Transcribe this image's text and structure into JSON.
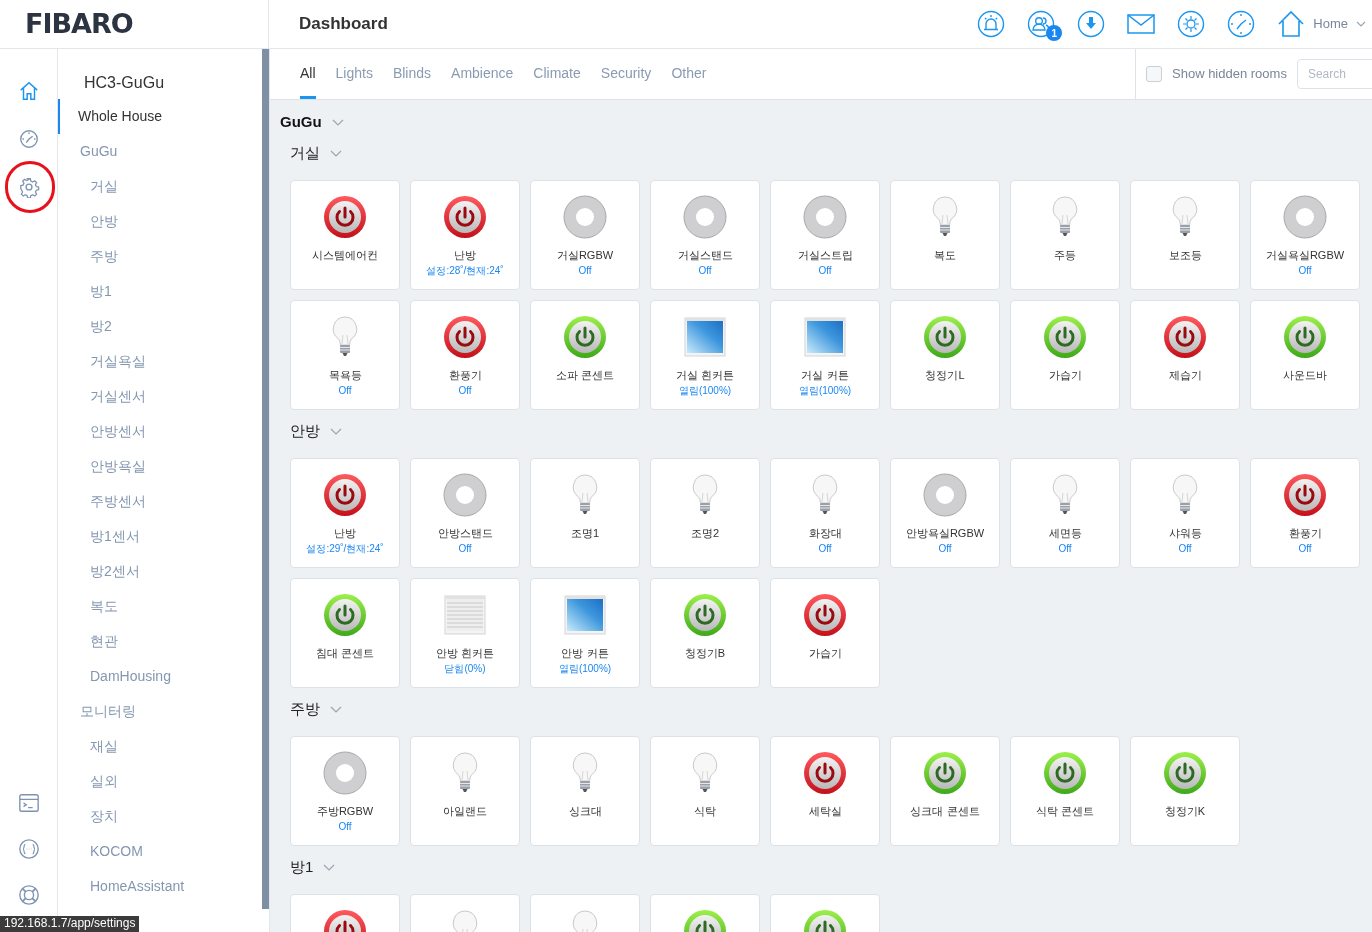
{
  "logo": "FIBARO",
  "page_title": "Dashboard",
  "header_icons": [
    {
      "kind": "alarm"
    },
    {
      "kind": "users",
      "badge": "1"
    },
    {
      "kind": "download"
    },
    {
      "kind": "mail"
    },
    {
      "kind": "sun"
    },
    {
      "kind": "clock"
    }
  ],
  "location": {
    "label": "Home"
  },
  "rail": [
    {
      "kind": "home",
      "selected": true,
      "highlighted": false
    },
    {
      "kind": "clock",
      "selected": false,
      "highlighted": false
    },
    {
      "kind": "settings",
      "selected": false,
      "highlighted": true
    }
  ],
  "rail_bottom": [
    {
      "kind": "terminal"
    },
    {
      "kind": "braces"
    },
    {
      "kind": "lifebuoy"
    }
  ],
  "sidebar": {
    "title": "HC3-GuGu",
    "items": [
      {
        "label": "Whole House",
        "selected": true
      },
      {
        "label": "GuGu",
        "selected": false,
        "children": [
          {
            "label": "거실"
          },
          {
            "label": "안방"
          },
          {
            "label": "주방"
          },
          {
            "label": "방1"
          },
          {
            "label": "방2"
          },
          {
            "label": "거실욕실"
          },
          {
            "label": "거실센서"
          },
          {
            "label": "안방센서"
          },
          {
            "label": "안방욕실"
          },
          {
            "label": "주방센서"
          },
          {
            "label": "방1센서"
          },
          {
            "label": "방2센서"
          },
          {
            "label": "복도"
          },
          {
            "label": "현관"
          },
          {
            "label": "DamHousing"
          }
        ]
      },
      {
        "label": "모니터링",
        "selected": false,
        "children": [
          {
            "label": "재실"
          },
          {
            "label": "실외"
          },
          {
            "label": "장치"
          },
          {
            "label": "KOCOM"
          },
          {
            "label": "HomeAssistant"
          }
        ]
      }
    ]
  },
  "tabs": [
    {
      "label": "All",
      "selected": true
    },
    {
      "label": "Lights",
      "selected": false
    },
    {
      "label": "Blinds",
      "selected": false
    },
    {
      "label": "Ambience",
      "selected": false
    },
    {
      "label": "Climate",
      "selected": false
    },
    {
      "label": "Security",
      "selected": false
    },
    {
      "label": "Other",
      "selected": false
    }
  ],
  "hidden_rooms": {
    "label": "Show hidden rooms",
    "checked": false
  },
  "search": {
    "placeholder": "Search"
  },
  "section": "GuGu",
  "rooms": [
    {
      "name": "거실",
      "devices": [
        {
          "kind": "switch",
          "on": false,
          "name": "시스템에어컨"
        },
        {
          "kind": "switch",
          "on": false,
          "name": "난방",
          "status": "설정:28˚/현재:24˚"
        },
        {
          "kind": "rgbw",
          "name": "거실RGBW",
          "status": "Off"
        },
        {
          "kind": "rgbw",
          "name": "거실스탠드",
          "status": "Off"
        },
        {
          "kind": "rgbw",
          "name": "거실스트립",
          "status": "Off"
        },
        {
          "kind": "bulb",
          "name": "복도"
        },
        {
          "kind": "bulb",
          "name": "주등"
        },
        {
          "kind": "bulb",
          "name": "보조등"
        },
        {
          "kind": "rgbw",
          "name": "거실욕실RGBW",
          "status": "Off"
        },
        {
          "kind": "bulb",
          "name": "목욕등",
          "status": "Off"
        },
        {
          "kind": "switch",
          "on": false,
          "name": "환풍기",
          "status": "Off"
        },
        {
          "kind": "switch",
          "on": true,
          "name": "소파 콘센트"
        },
        {
          "kind": "blind",
          "open": true,
          "name": "거실 흰커튼",
          "status": "열림(100%)"
        },
        {
          "kind": "blind",
          "open": true,
          "name": "거실 커튼",
          "status": "열림(100%)"
        },
        {
          "kind": "switch",
          "on": true,
          "name": "청정기L"
        },
        {
          "kind": "switch",
          "on": true,
          "name": "가습기"
        },
        {
          "kind": "switch",
          "on": false,
          "name": "제습기"
        },
        {
          "kind": "switch",
          "on": true,
          "name": "사운드바"
        }
      ]
    },
    {
      "name": "안방",
      "devices": [
        {
          "kind": "switch",
          "on": false,
          "name": "난방",
          "status": "설정:29˚/현재:24˚"
        },
        {
          "kind": "rgbw",
          "name": "안방스탠드",
          "status": "Off"
        },
        {
          "kind": "bulb",
          "name": "조명1"
        },
        {
          "kind": "bulb",
          "name": "조명2"
        },
        {
          "kind": "bulb",
          "name": "화장대",
          "status": "Off"
        },
        {
          "kind": "rgbw",
          "name": "안방욕실RGBW",
          "status": "Off"
        },
        {
          "kind": "bulb",
          "name": "세면등",
          "status": "Off"
        },
        {
          "kind": "bulb",
          "name": "샤워등",
          "status": "Off"
        },
        {
          "kind": "switch",
          "on": false,
          "name": "환풍기",
          "status": "Off"
        },
        {
          "kind": "switch",
          "on": true,
          "name": "침대 콘센트"
        },
        {
          "kind": "blind",
          "open": false,
          "name": "안방 흰커튼",
          "status": "닫힘(0%)"
        },
        {
          "kind": "blind",
          "open": true,
          "name": "안방 커튼",
          "status": "열림(100%)"
        },
        {
          "kind": "switch",
          "on": true,
          "name": "청정기B"
        },
        {
          "kind": "switch",
          "on": false,
          "name": "가습기"
        }
      ]
    },
    {
      "name": "주방",
      "devices": [
        {
          "kind": "rgbw",
          "name": "주방RGBW",
          "status": "Off"
        },
        {
          "kind": "bulb",
          "name": "아일랜드"
        },
        {
          "kind": "bulb",
          "name": "싱크대"
        },
        {
          "kind": "bulb",
          "name": "식탁"
        },
        {
          "kind": "switch",
          "on": false,
          "name": "세탁실"
        },
        {
          "kind": "switch",
          "on": true,
          "name": "싱크대 콘센트"
        },
        {
          "kind": "switch",
          "on": true,
          "name": "식탁 콘센트"
        },
        {
          "kind": "switch",
          "on": true,
          "name": "청정기K"
        }
      ]
    },
    {
      "name": "방1",
      "devices": [
        {
          "kind": "switch",
          "on": false
        },
        {
          "kind": "bulb"
        },
        {
          "kind": "bulb"
        },
        {
          "kind": "switch",
          "on": true
        },
        {
          "kind": "switch",
          "on": true
        }
      ]
    }
  ],
  "link_preview": "192.168.1.7/app/settings"
}
